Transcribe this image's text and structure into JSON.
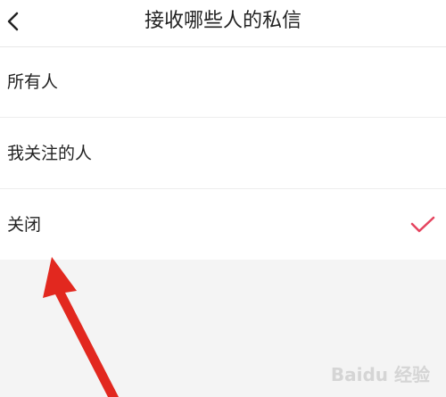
{
  "header": {
    "back_icon": "chevron-left-icon",
    "title": "接收哪些人的私信"
  },
  "options": [
    {
      "label": "所有人",
      "selected": false
    },
    {
      "label": "我关注的人",
      "selected": false
    },
    {
      "label": "关闭",
      "selected": true
    }
  ],
  "colors": {
    "accent": "#e5445f",
    "arrow": "#e2281f"
  },
  "watermark": "Baidu 经验"
}
